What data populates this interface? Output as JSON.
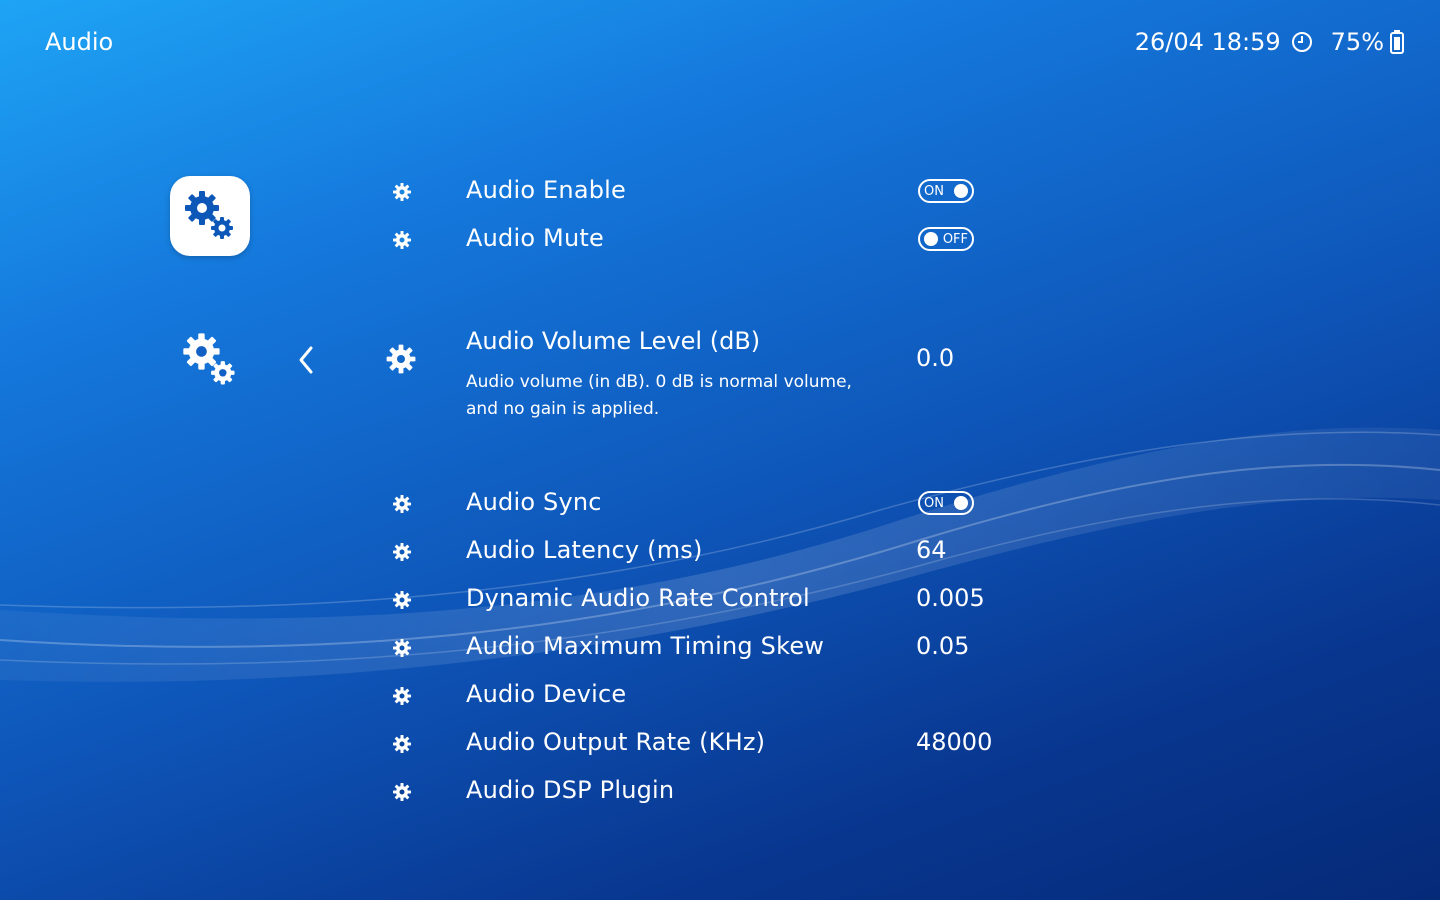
{
  "header": {
    "title": "Audio",
    "datetime": "26/04 18:59",
    "battery": "75%"
  },
  "icons": {
    "category": "settings-gears-icon",
    "back": "chevron-left-icon",
    "item": "gear-icon",
    "clock": "clock-icon",
    "battery": "battery-icon"
  },
  "colors": {
    "bg_top": "#1ea4f5",
    "bg_bottom": "#052a78",
    "accent": "#0d57b8"
  },
  "menu": {
    "items": [
      {
        "label": "Audio Enable",
        "toggle": "ON"
      },
      {
        "label": "Audio Mute",
        "toggle": "OFF"
      },
      {
        "label": "Audio Volume Level (dB)",
        "value": "0.0",
        "description": "Audio volume (in dB). 0 dB is normal volume, and no gain is applied."
      },
      {
        "label": "Audio Sync",
        "toggle": "ON"
      },
      {
        "label": "Audio Latency (ms)",
        "value": "64"
      },
      {
        "label": "Dynamic Audio Rate Control",
        "value": "0.005"
      },
      {
        "label": "Audio Maximum Timing Skew",
        "value": "0.05"
      },
      {
        "label": "Audio Device",
        "value": ""
      },
      {
        "label": "Audio Output Rate (KHz)",
        "value": "48000"
      },
      {
        "label": "Audio DSP Plugin",
        "value": ""
      }
    ]
  }
}
